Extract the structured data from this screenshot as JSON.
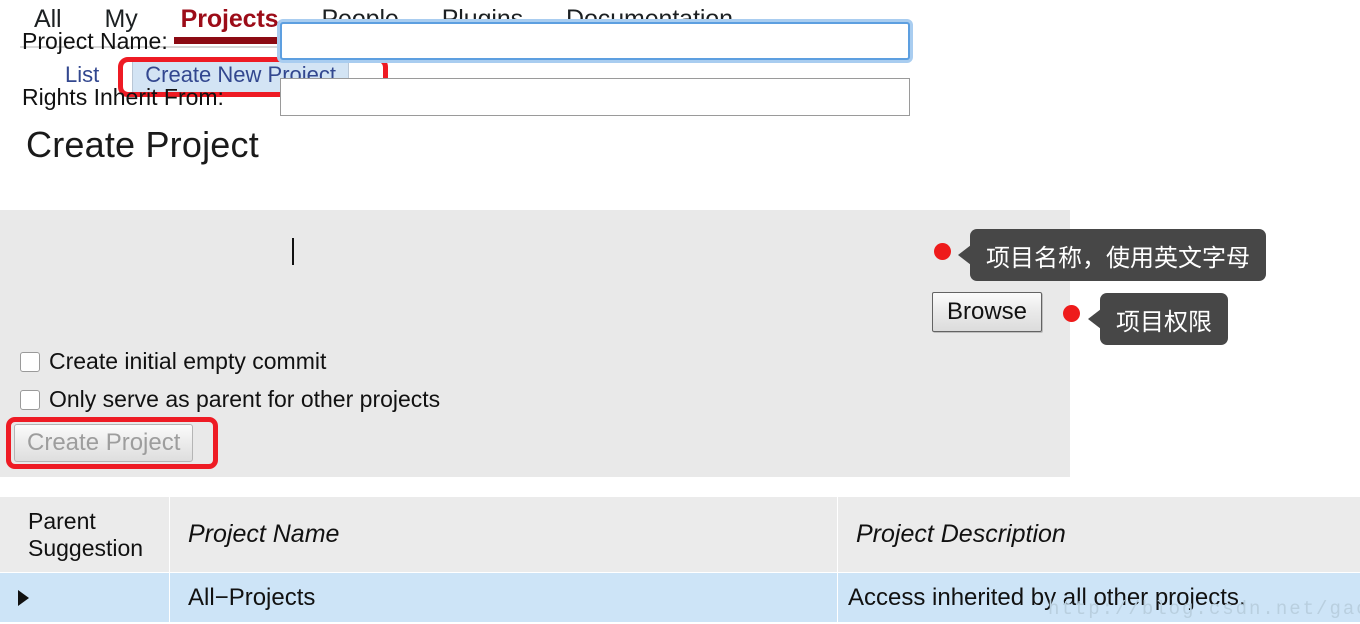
{
  "colors": {
    "active_tab": "#9c0c18",
    "subnav_link": "#32478f",
    "annotation_red": "#ee1b24",
    "tooltip_bg": "#474747",
    "panel_bg": "#e9e9e9",
    "table_header_bg": "#ebebeb",
    "table_row_highlight": "#cde4f7"
  },
  "topnav": {
    "items": [
      {
        "label": "All",
        "active": false
      },
      {
        "label": "My",
        "active": false
      },
      {
        "label": "Projects",
        "active": true
      },
      {
        "label": "People",
        "active": false
      },
      {
        "label": "Plugins",
        "active": false
      },
      {
        "label": "Documentation",
        "active": false
      }
    ]
  },
  "subnav": {
    "items": [
      {
        "label": "List",
        "selected": false
      },
      {
        "label": "Create New Project",
        "selected": true
      }
    ]
  },
  "page": {
    "title": "Create Project"
  },
  "form": {
    "project_name": {
      "label": "Project Name:",
      "value": "",
      "placeholder": ""
    },
    "rights_inherit": {
      "label": "Rights Inherit From:",
      "value": "",
      "placeholder": ""
    },
    "browse_button": "Browse",
    "checkboxes": [
      {
        "label": "Create initial empty commit",
        "checked": false
      },
      {
        "label": "Only serve as parent for other projects",
        "checked": false
      }
    ],
    "submit_button": "Create Project"
  },
  "tooltips": [
    {
      "text": "项目名称，使用英文字母"
    },
    {
      "text": "项目权限"
    }
  ],
  "table": {
    "headers": {
      "parent_suggestion_line1": "Parent",
      "parent_suggestion_line2": "Suggestion",
      "project_name": "Project Name",
      "project_description": "Project Description"
    },
    "rows": [
      {
        "expander": "▶",
        "name": "All−Projects",
        "description": "Access inherited by all other projects."
      }
    ]
  },
  "watermark": {
    "text": "http://blog.csdn.net/gaoshujia"
  }
}
